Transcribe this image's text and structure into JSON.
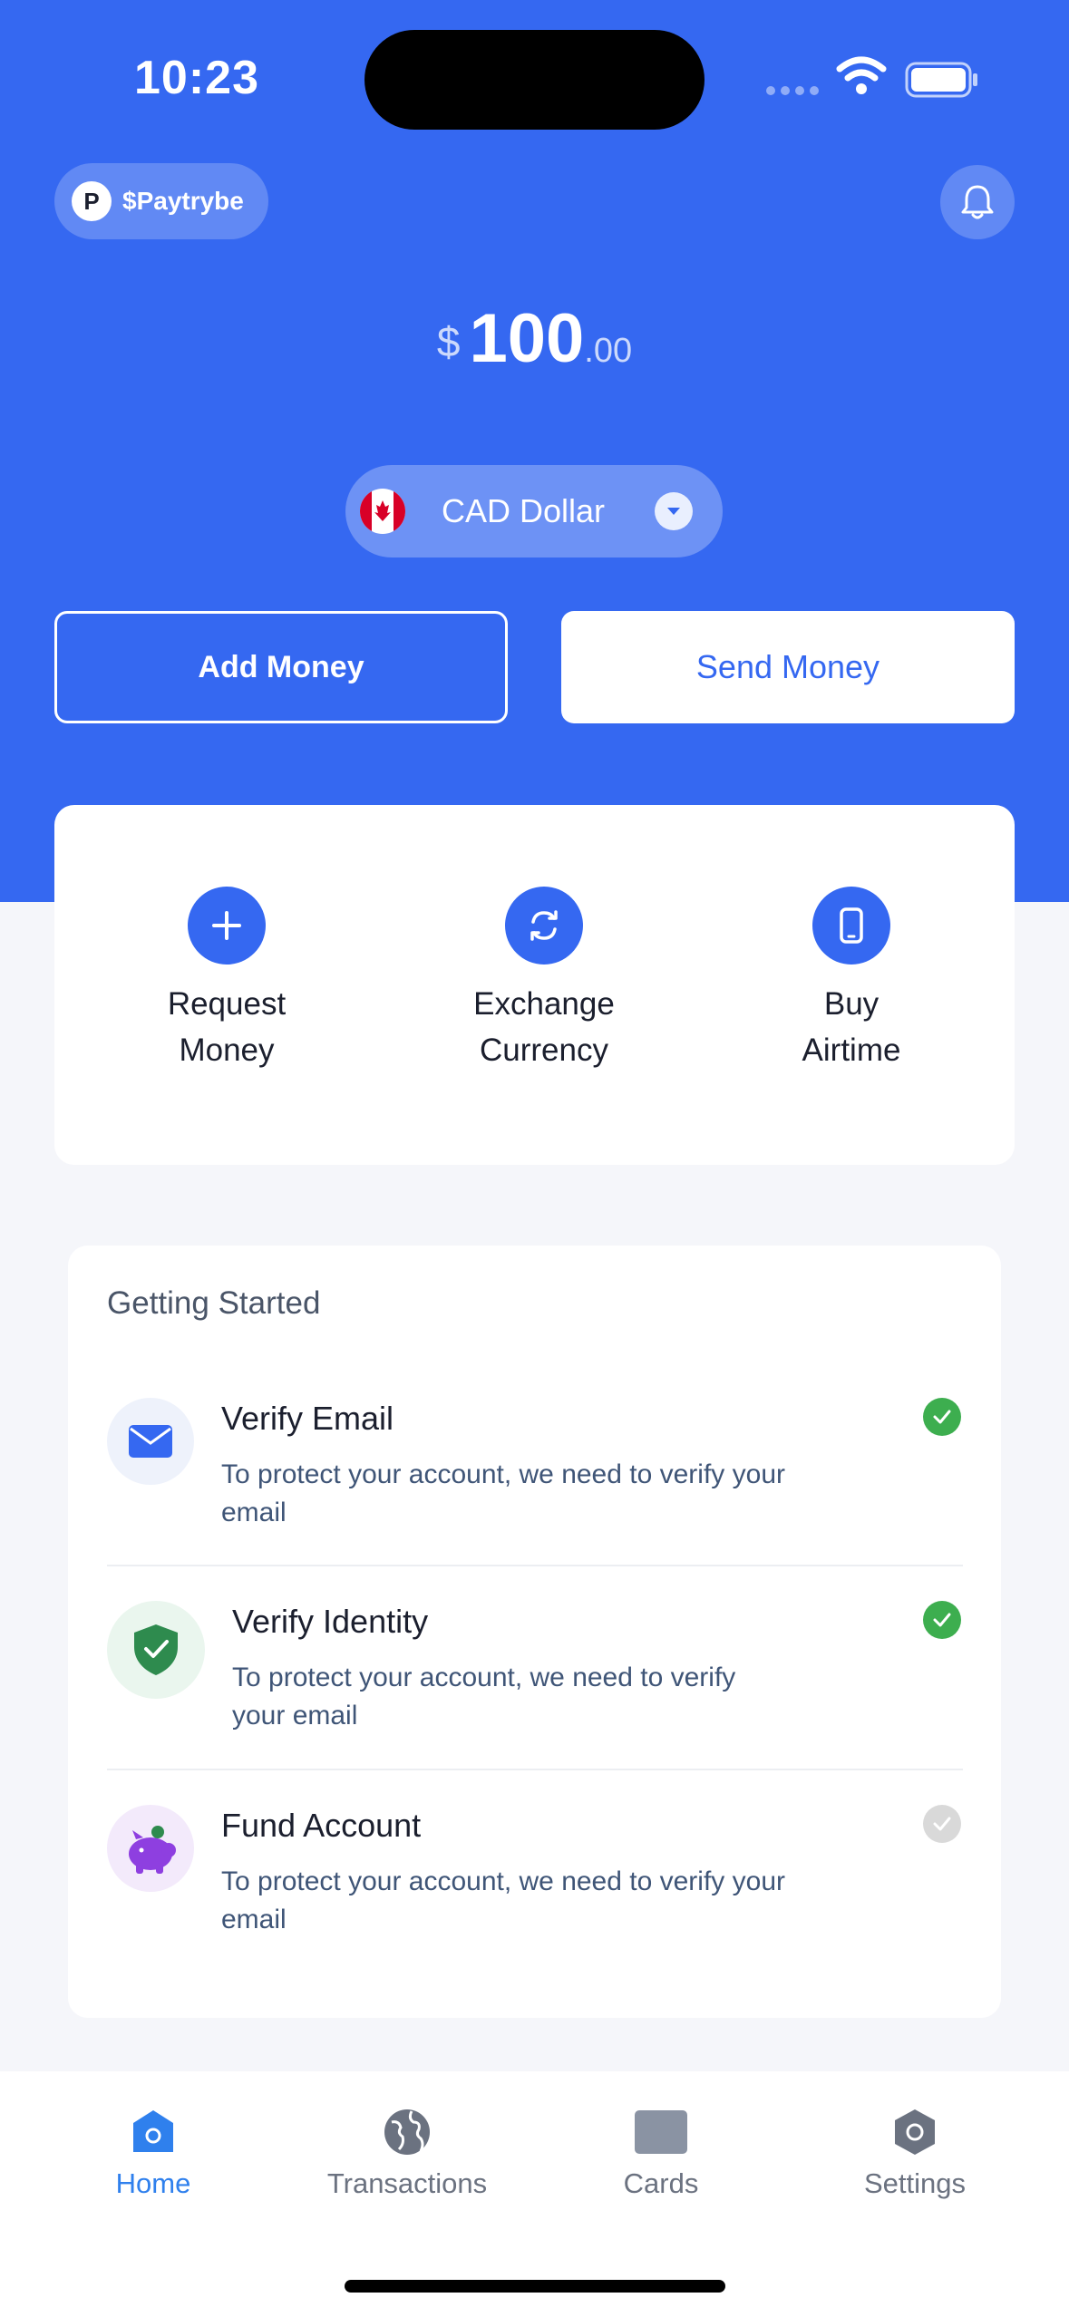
{
  "status_bar": {
    "time": "10:23"
  },
  "header": {
    "brand_initial": "P",
    "brand_name": "$Paytrybe"
  },
  "balance": {
    "currency_symbol": "$",
    "amount": "100",
    "cents": ".00"
  },
  "currency_selector": {
    "label": "CAD Dollar",
    "flag": "canada-flag-icon"
  },
  "actions": {
    "add_money": "Add Money",
    "send_money": "Send Money"
  },
  "quick_actions": [
    {
      "line1": "Request",
      "line2": "Money",
      "icon": "plus-icon"
    },
    {
      "line1": "Exchange",
      "line2": "Currency",
      "icon": "exchange-icon"
    },
    {
      "line1": "Buy",
      "line2": "Airtime",
      "icon": "phone-icon"
    }
  ],
  "getting_started": {
    "title": "Getting Started",
    "tasks": [
      {
        "title": "Verify Email",
        "line1": "To protect your account, we need to verify your",
        "line2": "email",
        "done": true,
        "icon": "envelope-icon"
      },
      {
        "title": "Verify Identity",
        "line1": "To protect your account, we need to verify",
        "line2": "your email",
        "done": true,
        "icon": "shield-check-icon"
      },
      {
        "title": "Fund Account",
        "line1": "To protect your account, we need to verify your",
        "line2": "email",
        "done": false,
        "icon": "piggy-bank-icon"
      }
    ]
  },
  "tab_bar": [
    {
      "label": "Home",
      "active": true,
      "icon": "home-icon"
    },
    {
      "label": "Transactions",
      "active": false,
      "icon": "globe-icon"
    },
    {
      "label": "Cards",
      "active": false,
      "icon": "card-icon"
    },
    {
      "label": "Settings",
      "active": false,
      "icon": "settings-icon"
    }
  ],
  "colors": {
    "primary": "#3568F1",
    "success": "#3DAE4F",
    "inactive_check": "#D9D9D9",
    "tab_active": "#2F80ED"
  }
}
